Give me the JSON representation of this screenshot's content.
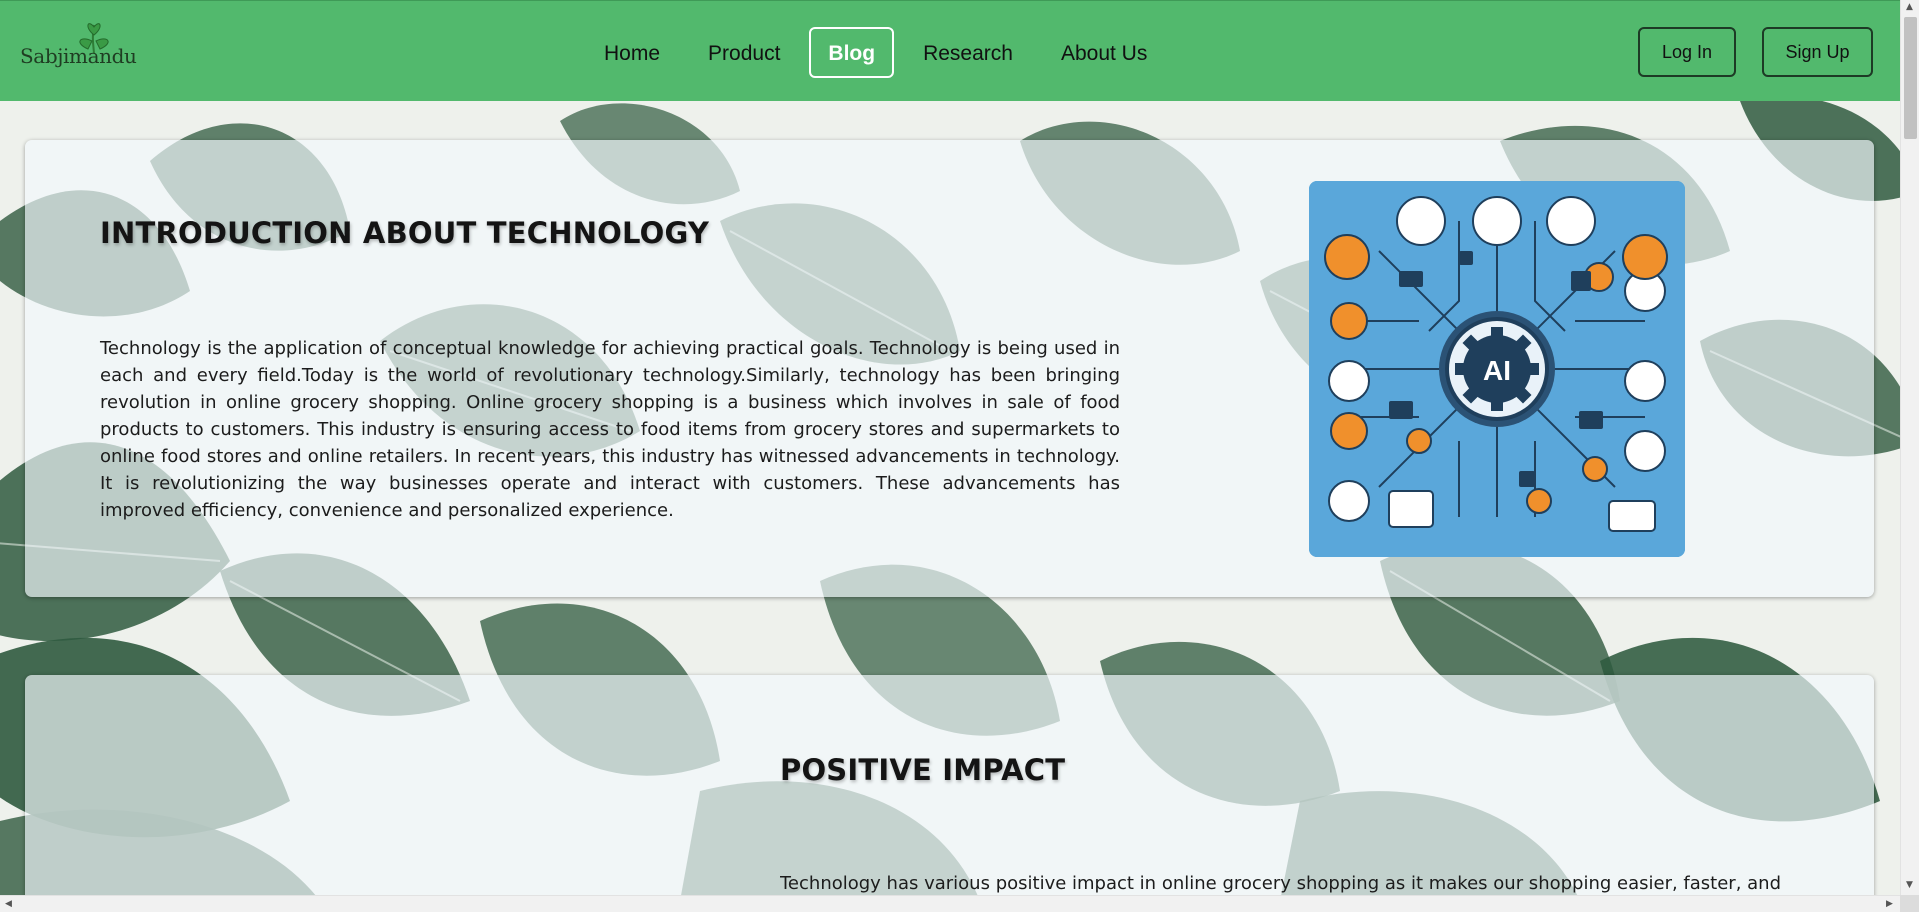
{
  "brand": {
    "name": "Sabjimandu"
  },
  "nav": {
    "links": [
      {
        "label": "Home",
        "active": false
      },
      {
        "label": "Product",
        "active": false
      },
      {
        "label": "Blog",
        "active": true
      },
      {
        "label": "Research",
        "active": false
      },
      {
        "label": "About Us",
        "active": false
      }
    ],
    "login_label": "Log In",
    "signup_label": "Sign Up"
  },
  "intro": {
    "title": "INTRODUCTION ABOUT TECHNOLOGY",
    "text": "Technology is the application of conceptual knowledge for achieving practical goals. Technology is being used in each and every field.Today is the world of revolutionary technology.Similarly, technology has been bringing revolution in online grocery shopping. Online grocery shopping is a business which involves in sale of food products to customers. This industry is ensuring access to food items from grocery stores and supermarkets to online food stores and online retailers. In recent years, this industry has witnessed advancements in technology. It is revolutionizing the way businesses operate and interact with customers. These advancements has improved efficiency, convenience and personalized experience.",
    "image_center_label": "AI"
  },
  "positive": {
    "title": "POSITIVE IMPACT",
    "text": "Technology has various positive impact in online grocery shopping as it makes our shopping easier, faster, and"
  },
  "colors": {
    "navbar": "#52b96d",
    "accent_orange": "#f0902c",
    "ai_panel": "#5aa7da"
  }
}
